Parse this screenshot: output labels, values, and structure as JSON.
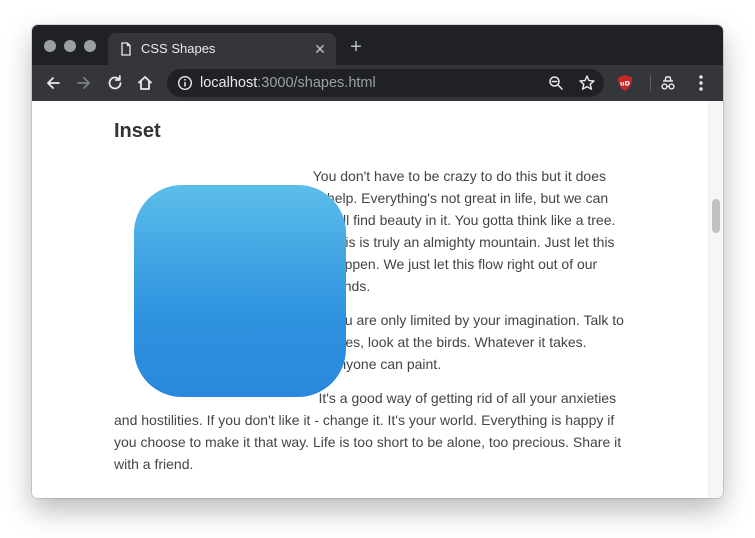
{
  "browser": {
    "tab": {
      "title": "CSS Shapes",
      "icon": "document-icon"
    },
    "new_tab_label": "+",
    "toolbar": {
      "url_host": "localhost",
      "url_rest": ":3000/shapes.html"
    }
  },
  "page": {
    "heading": "Inset",
    "paragraphs": [
      "You don't have to be crazy to do this but it does help. Everything's not great in life, but we can still find beauty in it. You gotta think like a tree. This is truly an almighty mountain. Just let this happen. We just let this flow right out of our minds.",
      "You are only limited by your imagination. Talk to trees, look at the birds. Whatever it takes. Anyone can paint.",
      "It's a good way of getting rid of all your anxieties and hostilities. If you don't like it - change it. It's your world. Everything is happy if you choose to make it that way. Life is too short to be alone, too precious. Share it with a friend."
    ],
    "shape_gradient": [
      "#5bbde9",
      "#2a88dc"
    ]
  },
  "colors": {
    "tabbar": "#202124",
    "toolbar": "#35363a",
    "text": "#444444",
    "ublock": "#c62828"
  }
}
